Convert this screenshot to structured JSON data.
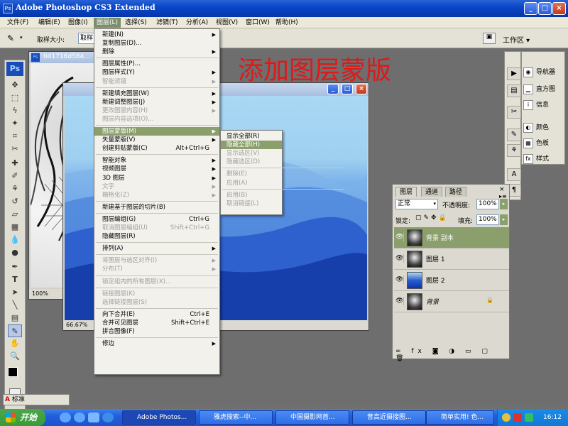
{
  "app": {
    "title": "Adobe Photoshop CS3 Extended",
    "ps_logo": "Ps"
  },
  "menubar": [
    "文件(F)",
    "编辑(E)",
    "图像(I)",
    "图层(L)",
    "选择(S)",
    "滤镜(T)",
    "分析(A)",
    "视图(V)",
    "窗口(W)",
    "帮助(H)"
  ],
  "options": {
    "sample_size_label": "取样大小:",
    "sample_size_value": "取样",
    "workspace_label": "工作区 ▾"
  },
  "overlay_title": "添加图层蒙版",
  "doc1": {
    "title": "041716d584...",
    "zoom": "100%"
  },
  "doc2": {
    "zoom": "66.67%"
  },
  "layer_menu": [
    {
      "label": "新建(N)",
      "arrow": true
    },
    {
      "label": "复制图层(D)..."
    },
    {
      "label": "删除",
      "arrow": true
    },
    {
      "sep": true
    },
    {
      "label": "图层属性(P)..."
    },
    {
      "label": "图层样式(Y)",
      "arrow": true
    },
    {
      "label": "智能滤镜",
      "disabled": true,
      "arrow": true
    },
    {
      "sep": true
    },
    {
      "label": "新建填充图层(W)",
      "arrow": true
    },
    {
      "label": "新建调整图层(J)",
      "arrow": true
    },
    {
      "label": "更改图层内容(H)",
      "disabled": true,
      "arrow": true
    },
    {
      "label": "图层内容选项(O)...",
      "disabled": true
    },
    {
      "sep": true
    },
    {
      "label": "图层蒙版(M)",
      "arrow": true,
      "highlight": true
    },
    {
      "label": "矢量蒙版(V)",
      "arrow": true
    },
    {
      "label": "创建剪贴蒙版(C)",
      "shortcut": "Alt+Ctrl+G"
    },
    {
      "sep": true
    },
    {
      "label": "智能对象",
      "arrow": true
    },
    {
      "label": "视频图层",
      "arrow": true
    },
    {
      "label": "3D 图层",
      "arrow": true
    },
    {
      "label": "文字",
      "disabled": true,
      "arrow": true
    },
    {
      "label": "栅格化(Z)",
      "disabled": true,
      "arrow": true
    },
    {
      "sep": true
    },
    {
      "label": "新建基于图层的切片(B)"
    },
    {
      "sep": true
    },
    {
      "label": "图层编组(G)",
      "shortcut": "Ctrl+G"
    },
    {
      "label": "取消图层编组(U)",
      "shortcut": "Shift+Ctrl+G",
      "disabled": true
    },
    {
      "label": "隐藏图层(R)"
    },
    {
      "sep": true
    },
    {
      "label": "排列(A)",
      "arrow": true
    },
    {
      "sep": true
    },
    {
      "label": "将图层与选区对齐(I)",
      "disabled": true,
      "arrow": true
    },
    {
      "label": "分布(T)",
      "disabled": true,
      "arrow": true
    },
    {
      "sep": true
    },
    {
      "label": "锁定组内的所有图层(X)...",
      "disabled": true
    },
    {
      "sep": true
    },
    {
      "label": "链接图层(K)",
      "disabled": true
    },
    {
      "label": "选择链接图层(S)",
      "disabled": true
    },
    {
      "sep": true
    },
    {
      "label": "向下合并(E)",
      "shortcut": "Ctrl+E"
    },
    {
      "label": "合并可见图层",
      "shortcut": "Shift+Ctrl+E"
    },
    {
      "label": "拼合图像(F)"
    },
    {
      "sep": true
    },
    {
      "label": "修边",
      "arrow": true
    }
  ],
  "submenu": [
    {
      "label": "显示全部(R)"
    },
    {
      "label": "隐藏全部(H)",
      "highlight": true
    },
    {
      "label": "显示选区(V)",
      "disabled": true
    },
    {
      "label": "隐藏选区(D)",
      "disabled": true
    },
    {
      "sep": true
    },
    {
      "label": "删除(E)",
      "disabled": true
    },
    {
      "label": "应用(A)",
      "disabled": true
    },
    {
      "sep": true
    },
    {
      "label": "启用(B)",
      "disabled": true
    },
    {
      "label": "取消链接(L)",
      "disabled": true
    }
  ],
  "dock": {
    "items": [
      "导航器",
      "直方图",
      "信息",
      "颜色",
      "色板",
      "样式"
    ]
  },
  "layers_panel": {
    "tabs": [
      "图层",
      "通道",
      "路径"
    ],
    "blend_mode": "正常",
    "opacity_label": "不透明度:",
    "opacity_value": "100%",
    "lock_label": "锁定:",
    "fill_label": "填充:",
    "fill_value": "100%",
    "layers": [
      {
        "name": "背景 副本",
        "selected": true
      },
      {
        "name": "图层 1"
      },
      {
        "name": "图层 2"
      },
      {
        "name": "背景",
        "locked": true
      }
    ]
  },
  "taskbar": {
    "start": "开始",
    "tasks": [
      "Adobe Photos...",
      "雅虎搜索--中...",
      "中国摄影网首...",
      "昔高近摄接图...",
      "简单实用! 色..."
    ],
    "clock": "16:12"
  },
  "bottom_left": {
    "label": "标准"
  }
}
